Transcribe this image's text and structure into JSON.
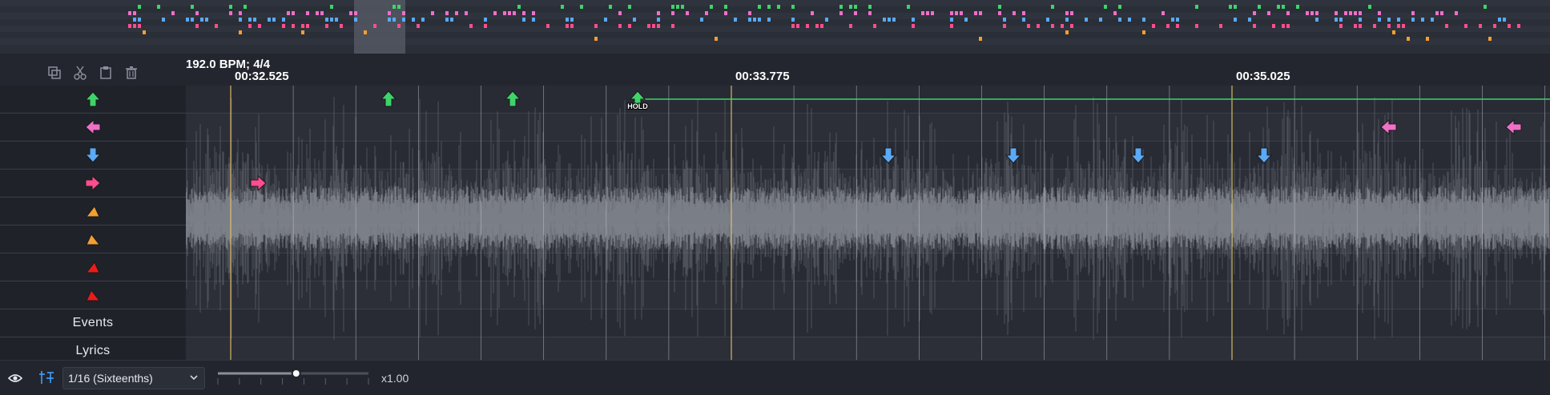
{
  "toolbar": {
    "icons": [
      "copy-icon",
      "cut-icon",
      "paste-icon",
      "delete-icon"
    ]
  },
  "timeline": {
    "bpm_label": "192.0 BPM; 4/4",
    "time_markers": [
      "00:32.525",
      "00:33.775",
      "00:35.025"
    ]
  },
  "lanes": [
    {
      "icon": "arrow-up-icon",
      "color": "#3fd36a"
    },
    {
      "icon": "arrow-left-icon",
      "color": "#f06fc8"
    },
    {
      "icon": "arrow-down-icon",
      "color": "#5aaaf5"
    },
    {
      "icon": "arrow-right-icon",
      "color": "#ff4d8f"
    },
    {
      "icon": "triangle-icon",
      "color": "#f29f32"
    },
    {
      "icon": "triangle-icon",
      "color": "#f29f32"
    },
    {
      "icon": "triangle-icon",
      "color": "#e81c1c"
    },
    {
      "icon": "triangle-icon",
      "color": "#e81c1c"
    },
    {
      "label": "Events"
    },
    {
      "label": "Lyrics"
    }
  ],
  "notes": {
    "hold_label": "HOLD"
  },
  "statusbar": {
    "snap_value": "1/16 (Sixteenths)",
    "zoom_label": "x1.00",
    "zoom_level": 0.52
  },
  "colors": {
    "accent": "#3fa0ff",
    "up": "#3fd36a",
    "left": "#f06fc8",
    "down": "#5aaaf5",
    "right": "#ff4d8f",
    "orange": "#f29f32",
    "red": "#e81c1c"
  }
}
